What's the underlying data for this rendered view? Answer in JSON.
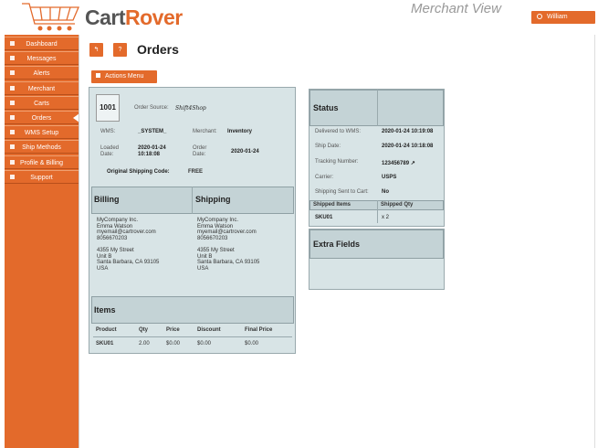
{
  "brand": {
    "cart": "Cart",
    "rover": "Rover",
    "accent": "#e36a2b"
  },
  "header": {
    "view_label": "Merchant View",
    "user_name": "William"
  },
  "nav": {
    "items": [
      {
        "label": "Dashboard",
        "icon": "dashboard-icon"
      },
      {
        "label": "Messages",
        "icon": "envelope-icon"
      },
      {
        "label": "Alerts",
        "icon": "warning-icon"
      },
      {
        "label": "Merchant",
        "icon": "user-icon"
      },
      {
        "label": "Carts",
        "icon": "cart-icon"
      },
      {
        "label": "Orders",
        "icon": "folder-icon",
        "active": true
      },
      {
        "label": "WMS Setup",
        "icon": "info-icon"
      },
      {
        "label": "Ship Methods",
        "icon": "truck-icon"
      },
      {
        "label": "Profile & Billing",
        "icon": "profile-icon"
      },
      {
        "label": "Support",
        "icon": "support-icon"
      }
    ]
  },
  "page": {
    "title": "Orders",
    "back_symbol": "↰",
    "help_symbol": "?",
    "actions_label": "Actions Menu"
  },
  "order": {
    "number": "1001",
    "source_label": "Order Source:",
    "source_value": "Shift4Shop",
    "wms_label": "WMS:",
    "wms_value": "_SYSTEM_",
    "merchant_label": "Merchant:",
    "merchant_value": "Inventory",
    "loaded_label_1": "Loaded",
    "loaded_label_2": "Date:",
    "loaded_date": "2020-01-24",
    "loaded_time": "10:18:08",
    "order_date_label_1": "Order",
    "order_date_label_2": "Date:",
    "order_date_value": "2020-01-24",
    "shipping_code_label": "Original Shipping Code:",
    "shipping_code_value": "FREE"
  },
  "billing": {
    "title": "Billing",
    "lines": [
      "MyCompany Inc.",
      "Emma Watson",
      "myemail@cartrover.com",
      "8056670203",
      "",
      "4355 My Street",
      "Unit B",
      "Santa Barbara, CA 93105",
      "USA"
    ]
  },
  "shipping": {
    "title": "Shipping",
    "lines": [
      "MyCompany Inc.",
      "Emma Watson",
      "myemail@cartrover.com",
      "8056670203",
      "",
      "4355 My Street",
      "Unit B",
      "Santa Barbara, CA 93105",
      "USA"
    ]
  },
  "items": {
    "title": "Items",
    "columns": [
      "Product",
      "Qty",
      "Price",
      "Discount",
      "Final Price"
    ],
    "rows": [
      {
        "product": "SKU01",
        "qty": "2.00",
        "price": "$0.00",
        "discount": "$0.00",
        "final": "$0.00"
      }
    ]
  },
  "status": {
    "title": "Status",
    "delivered_label": "Delivered to WMS:",
    "delivered_value": "2020-01-24 10:19:08",
    "ship_date_label": "Ship Date:",
    "ship_date_value": "2020-01-24 10:18:08",
    "tracking_label": "Tracking Number:",
    "tracking_value": "123456789",
    "carrier_label": "Carrier:",
    "carrier_value": "USPS",
    "sent_label": "Shipping Sent to Cart:",
    "sent_value": "No",
    "shipped_items_header": "Shipped Items",
    "shipped_qty_header": "Shipped Qty",
    "shipped_sku": "SKU01",
    "shipped_qty": "x 2"
  },
  "extra_fields": {
    "title": "Extra Fields"
  }
}
